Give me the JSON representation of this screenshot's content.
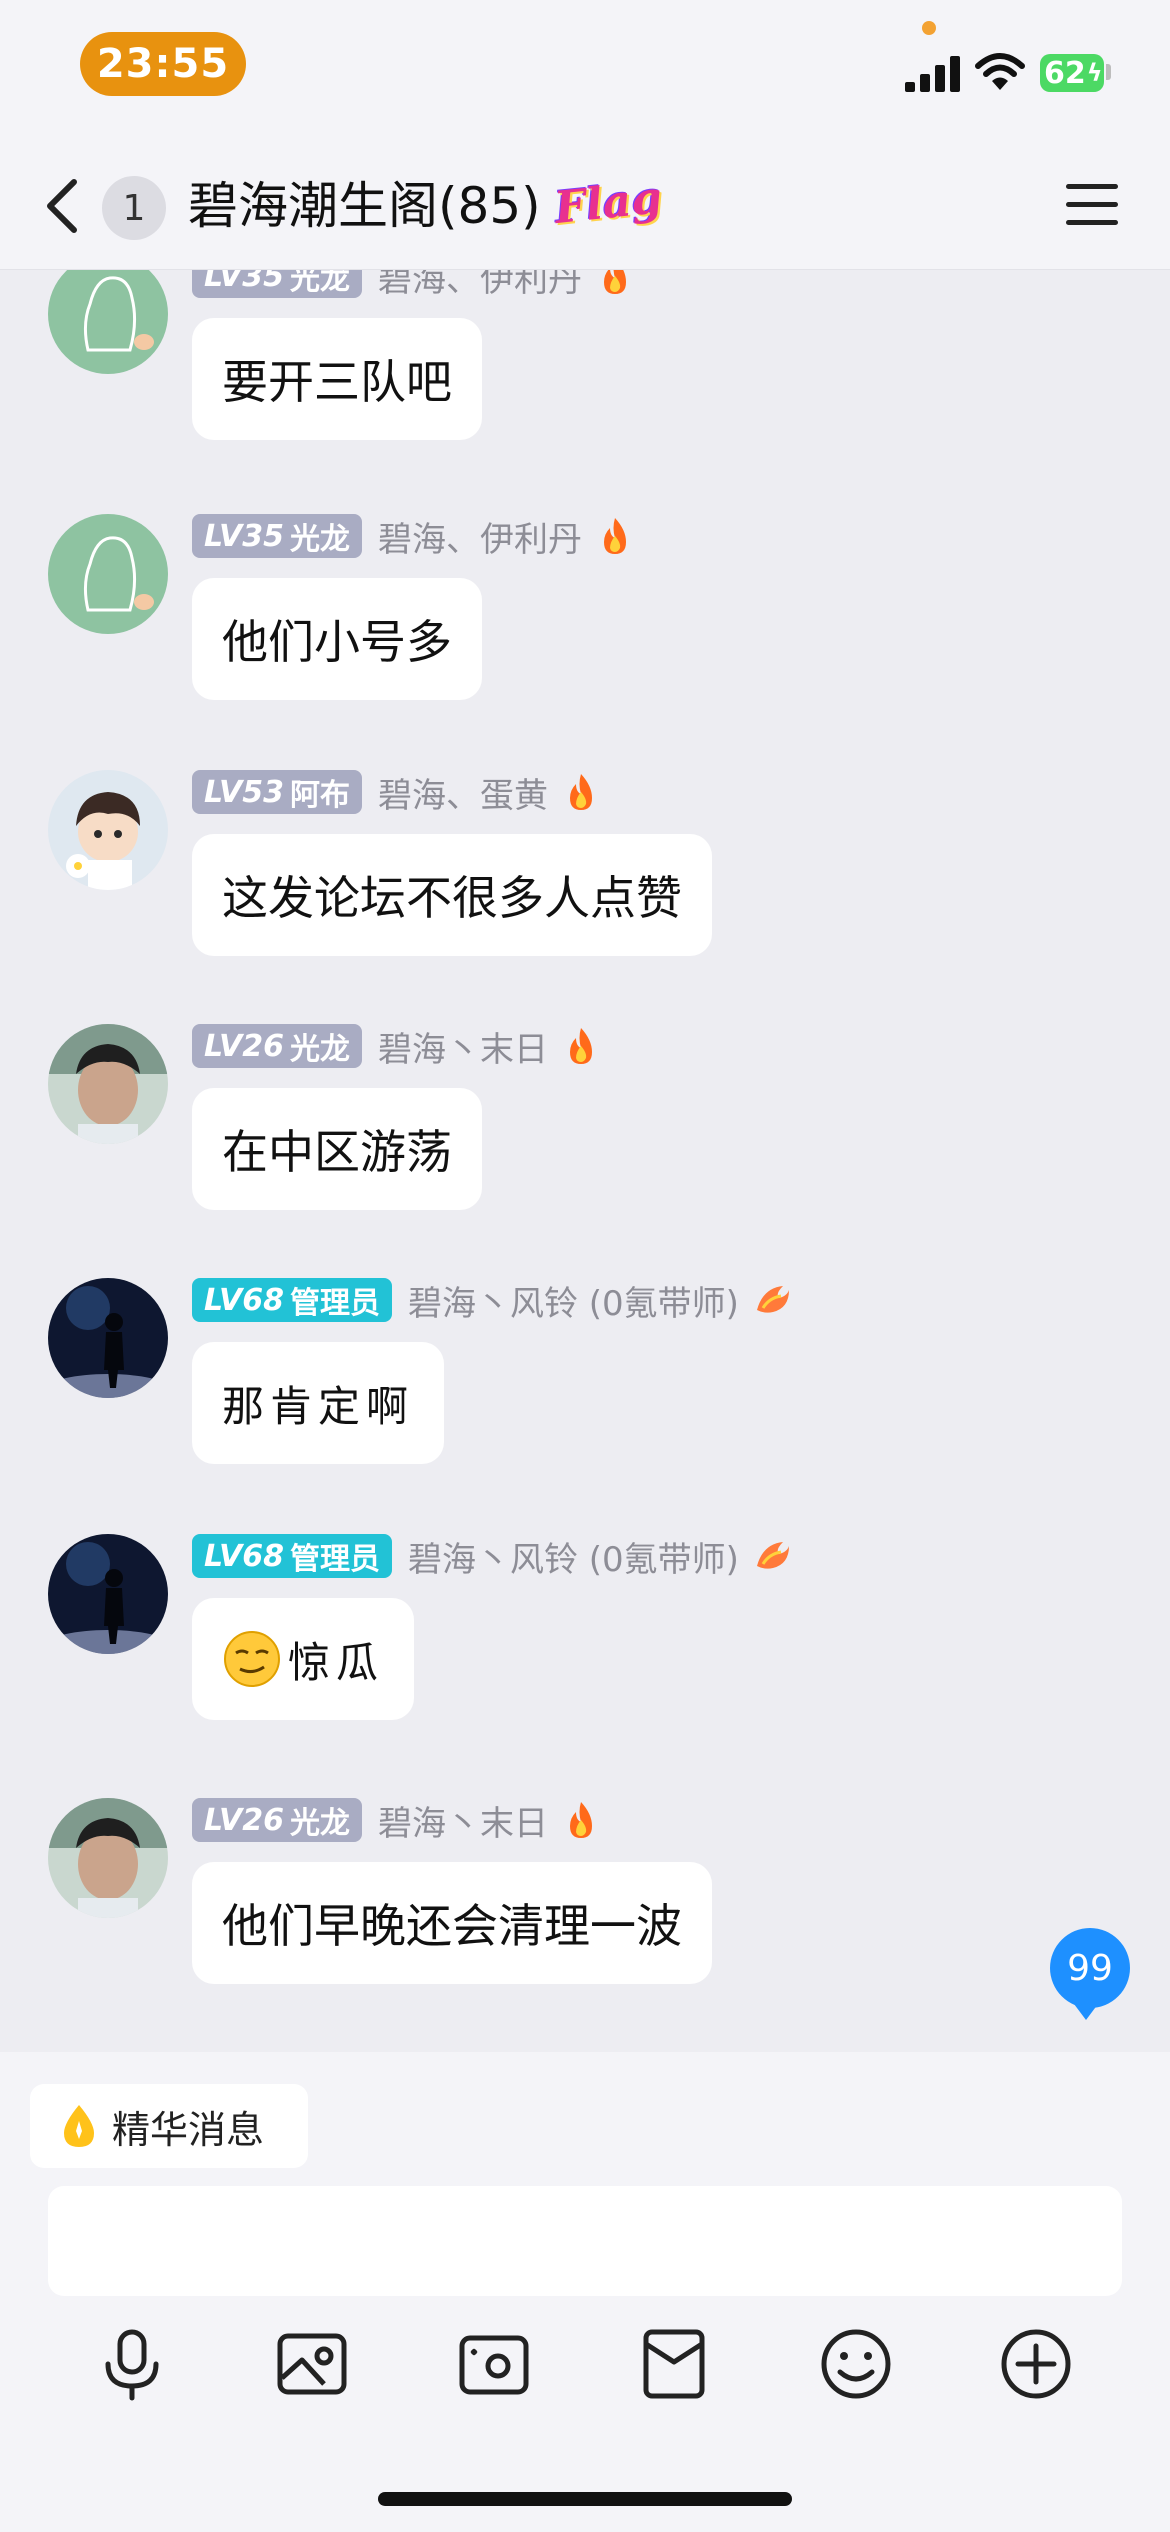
{
  "status_bar": {
    "time": "23:55",
    "battery_level": "62",
    "icons": [
      "signal-icon",
      "wifi-icon",
      "battery-charging-icon"
    ]
  },
  "header": {
    "unread_count": "1",
    "title": "碧海潮生阁(85)",
    "tag": "Flag"
  },
  "messages": [
    {
      "level": "LV35",
      "role": "光龙",
      "sender": "碧海、伊利丹",
      "text": "要开三队吧",
      "avatar": "default-qq-avatar",
      "badge_icon": "fire-icon"
    },
    {
      "level": "LV35",
      "role": "光龙",
      "sender": "碧海、伊利丹",
      "text": "他们小号多",
      "avatar": "default-qq-avatar",
      "badge_icon": "fire-icon"
    },
    {
      "level": "LV53",
      "role": "阿布",
      "sender": "碧海、蛋黄",
      "text": "这发论坛不很多人点赞",
      "avatar": "anime-boy-avatar",
      "badge_icon": "fire-icon"
    },
    {
      "level": "LV26",
      "role": "光龙",
      "sender": "碧海丶末日",
      "text": "在中区游荡",
      "avatar": "photo-avatar",
      "badge_icon": "fire-icon"
    },
    {
      "level": "LV68",
      "role": "管理员",
      "sender": "碧海丶风铃 (0氪带师)",
      "text": "那肯定啊",
      "avatar": "night-silhouette-avatar",
      "badge_icon": "dragon-icon"
    },
    {
      "level": "LV68",
      "role": "管理员",
      "sender": "碧海丶风铃 (0氪带师)",
      "text": "惊瓜",
      "avatar": "night-silhouette-avatar",
      "badge_icon": "dragon-icon",
      "emoji": "smirk-emoji-icon"
    },
    {
      "level": "LV26",
      "role": "光龙",
      "sender": "碧海丶末日",
      "text": "他们早晚还会清理一波",
      "avatar": "photo-avatar",
      "badge_icon": "fire-icon"
    }
  ],
  "new_message_count": "99",
  "bottom": {
    "featured_label": "精华消息",
    "input_value": "",
    "toolbar_icons": [
      "microphone-icon",
      "photo-icon",
      "camera-icon",
      "red-packet-icon",
      "emoji-icon",
      "plus-icon"
    ]
  },
  "colors": {
    "background": "#ededf2",
    "admin_badge": "#22c2d6",
    "level_badge": "#a9acc3",
    "time_pill": "#e8920f",
    "new_msg_badge": "#1e90ff"
  }
}
